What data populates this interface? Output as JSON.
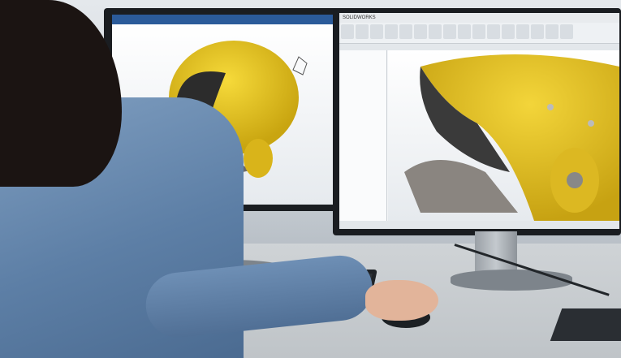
{
  "scene": {
    "description_free": true,
    "monitors": [
      {
        "app_title": "",
        "view": "3d-helmet-iso",
        "helmet_color": "#e6c21a"
      },
      {
        "app_title": "SOLIDWORKS",
        "view": "3d-helmet-closeup",
        "helmet_color": "#e6c21a",
        "tree_items": [
          "",
          "",
          "",
          "",
          "",
          "",
          "",
          "",
          "",
          "",
          "",
          ""
        ]
      }
    ],
    "colors": {
      "shirt": "#5d7fa6",
      "hair": "#1b1412",
      "helmet": "#e6c21a",
      "ui_blue": "#2b5b9a"
    }
  }
}
